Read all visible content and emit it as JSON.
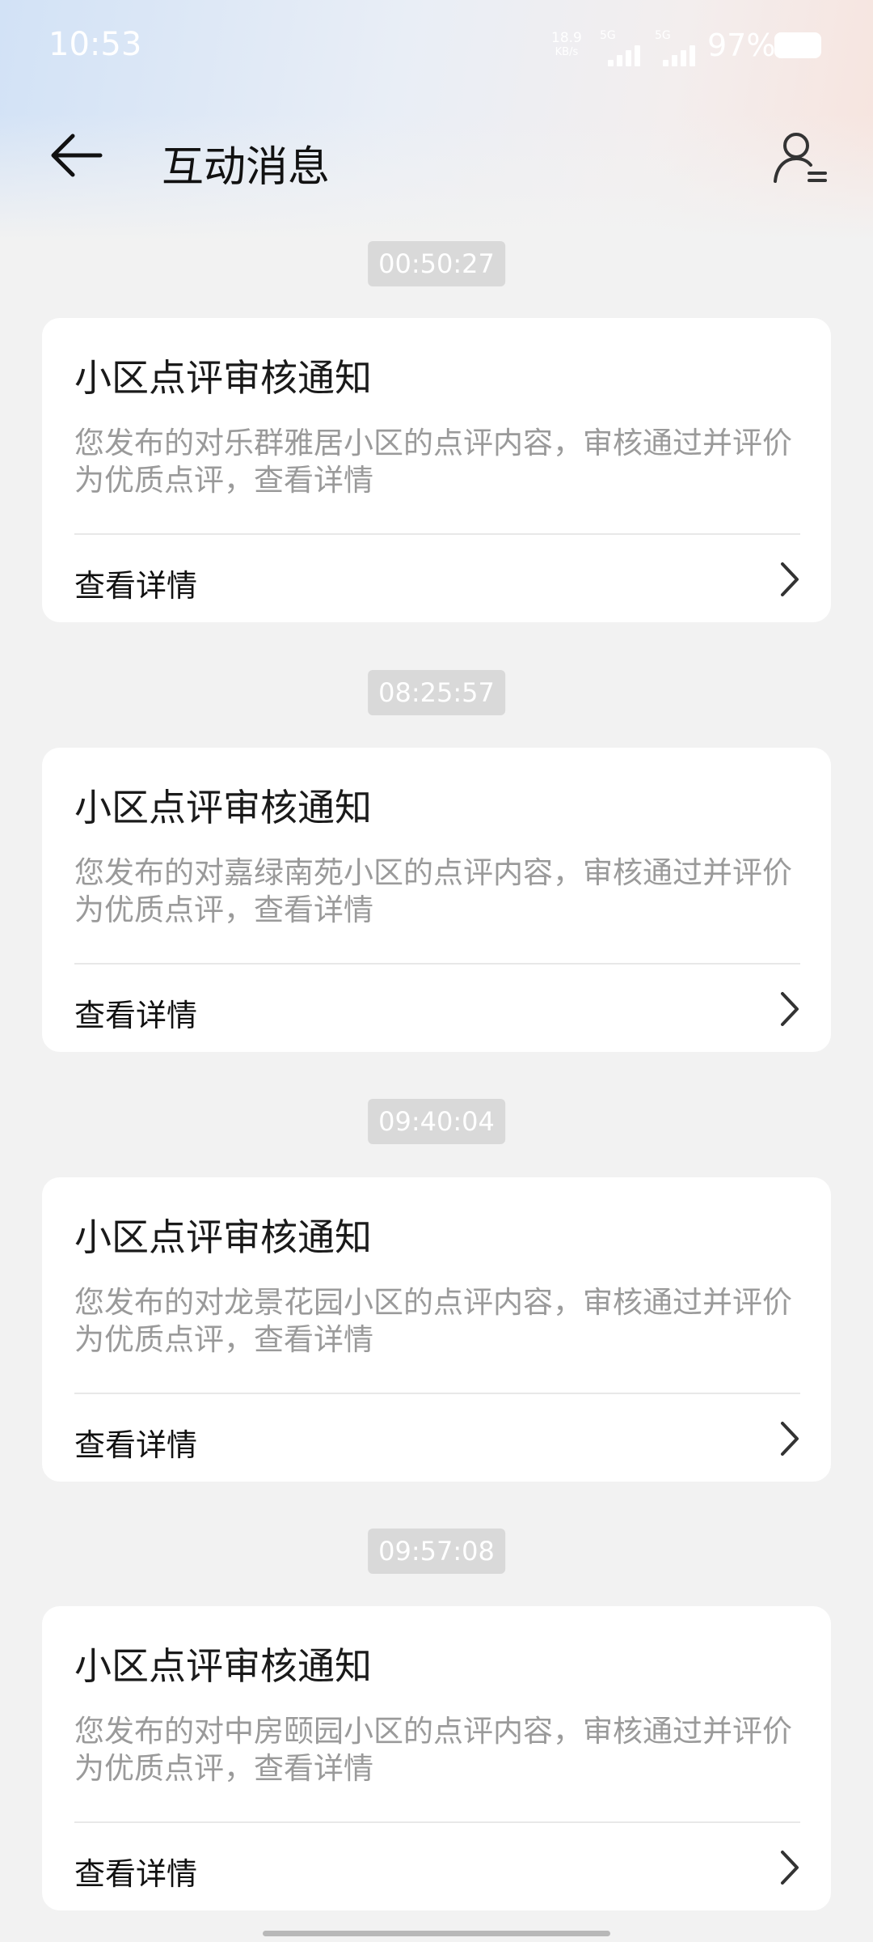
{
  "status_bar": {
    "time": "10:53",
    "net_speed_value": "18.9",
    "net_speed_unit": "KB/s",
    "sim1_tag": "5G",
    "sim2_tag": "5G",
    "battery": "97%"
  },
  "header": {
    "title": "互动消息",
    "back_icon": "arrow-left-icon",
    "user_icon": "user-list-icon"
  },
  "messages": [
    {
      "time": "00:50:27",
      "title": "小区点评审核通知",
      "body": "您发布的对乐群雅居小区的点评内容，审核通过并评价为优质点评，查看详情",
      "link": "查看详情"
    },
    {
      "time": "08:25:57",
      "title": "小区点评审核通知",
      "body": "您发布的对嘉绿南苑小区的点评内容，审核通过并评价为优质点评，查看详情",
      "link": "查看详情"
    },
    {
      "time": "09:40:04",
      "title": "小区点评审核通知",
      "body": "您发布的对龙景花园小区的点评内容，审核通过并评价为优质点评，查看详情",
      "link": "查看详情"
    },
    {
      "time": "09:57:08",
      "title": "小区点评审核通知",
      "body": "您发布的对中房颐园小区的点评内容，审核通过并评价为优质点评，查看详情",
      "link": "查看详情"
    }
  ]
}
